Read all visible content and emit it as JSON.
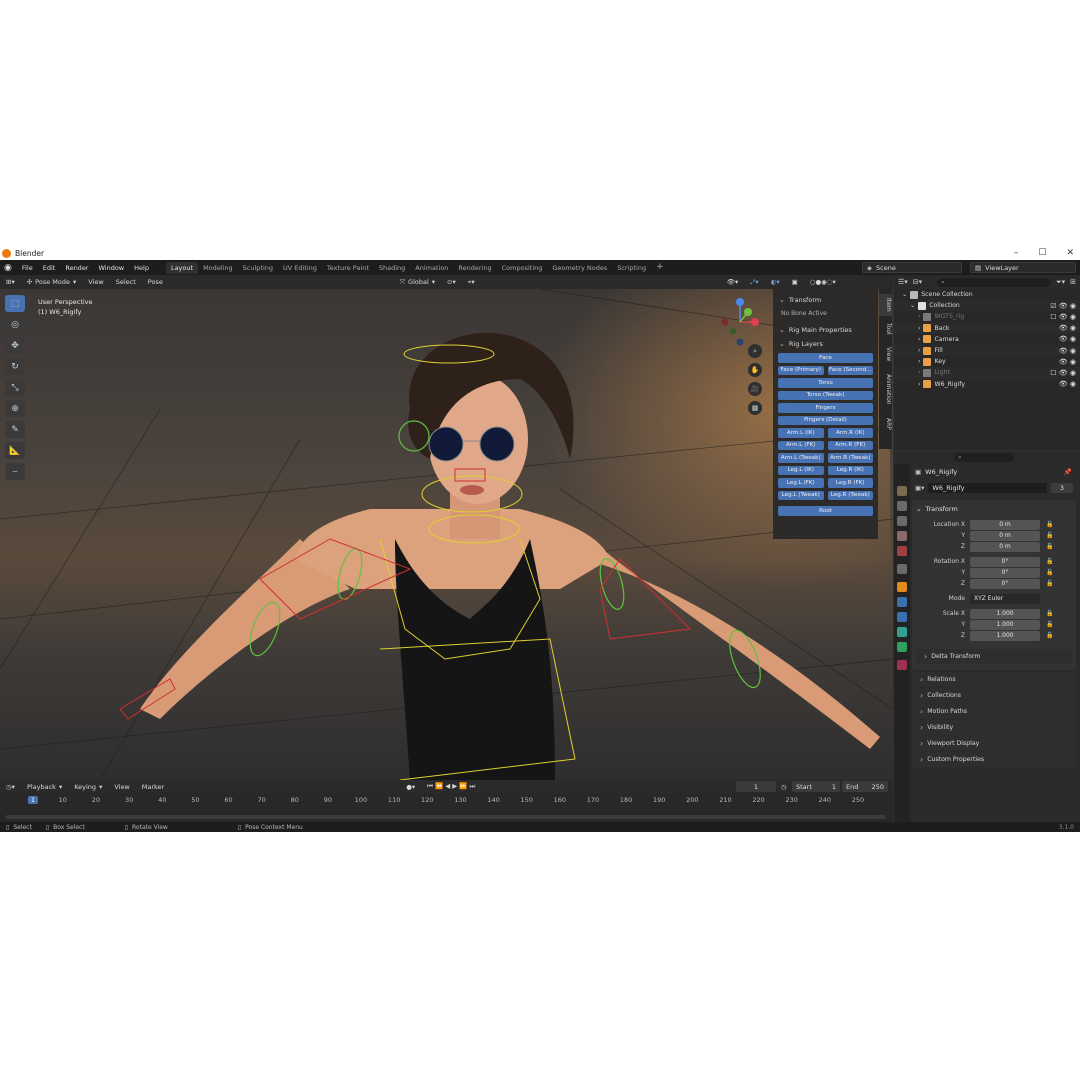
{
  "titlebar": {
    "title": "Blender",
    "minimize": "–",
    "maximize": "☐",
    "close": "✕"
  },
  "menu": [
    "File",
    "Edit",
    "Render",
    "Window",
    "Help"
  ],
  "workspaces": [
    "Layout",
    "Modeling",
    "Sculpting",
    "UV Editing",
    "Texture Paint",
    "Shading",
    "Animation",
    "Rendering",
    "Compositing",
    "Geometry Nodes",
    "Scripting"
  ],
  "scene": "Scene",
  "view_layer": "ViewLayer",
  "viewport_header": {
    "mode": "Pose Mode",
    "view": "View",
    "select": "Select",
    "pose": "Pose",
    "orientation": "Global",
    "pose_options": "Pose Options"
  },
  "viewport": {
    "perspective": "User Perspective",
    "object": "(1) W6_Rigify"
  },
  "npanel": {
    "transform": "Transform",
    "no_bone": "No Bone Active",
    "rig_main": "Rig Main Properties",
    "rig_layers": "Rig Layers",
    "layers": [
      [
        "Face"
      ],
      [
        "Face (Primary)",
        "Face (Second..."
      ],
      [
        "Torso"
      ],
      [
        "Torso (Tweak)"
      ],
      [
        "Fingers"
      ],
      [
        "Fingers (Detail)"
      ],
      [
        "Arm.L (IK)",
        "Arm.R (IK)"
      ],
      [
        "Arm.L (FK)",
        "Arm.R (FK)"
      ],
      [
        "Arm.L (Tweak)",
        "Arm.R (Tweak)"
      ],
      [
        "Leg.L (IK)",
        "Leg.R (IK)"
      ],
      [
        "Leg.L (FK)",
        "Leg.R (FK)"
      ],
      [
        "Leg.L (Tweak)",
        "Leg.R (Tweak)"
      ],
      [
        "Root"
      ]
    ],
    "tabs": [
      "Item",
      "Tool",
      "View",
      "Animation",
      "ARP"
    ]
  },
  "timeline": {
    "playback": "Playback",
    "keying": "Keying",
    "view": "View",
    "marker": "Marker",
    "current_frame": "1",
    "start_label": "Start",
    "start": "1",
    "end_label": "End",
    "end": "250",
    "ticks": [
      "1",
      "10",
      "20",
      "30",
      "40",
      "50",
      "60",
      "70",
      "80",
      "90",
      "100",
      "110",
      "120",
      "130",
      "140",
      "150",
      "160",
      "170",
      "180",
      "190",
      "200",
      "210",
      "220",
      "230",
      "240",
      "250"
    ]
  },
  "statusbar": {
    "select": "Select",
    "box_select": "Box Select",
    "rotate": "Rotate View",
    "context": "Pose Context Menu",
    "version": "3.1.0"
  },
  "outliner": {
    "rows": [
      {
        "label": "Scene Collection",
        "indent": 0,
        "color": "#b8b8b8"
      },
      {
        "label": "Collection",
        "indent": 1,
        "color": "#e0e0e0"
      },
      {
        "label": "WGTS_rig",
        "indent": 2,
        "color": "#7a7a7a",
        "dim": true
      },
      {
        "label": "Back",
        "indent": 2,
        "color": "#e8a040"
      },
      {
        "label": "Camera",
        "indent": 2,
        "color": "#e8a040"
      },
      {
        "label": "Fill",
        "indent": 2,
        "color": "#e8a040"
      },
      {
        "label": "Key",
        "indent": 2,
        "color": "#e8a040"
      },
      {
        "label": "Light",
        "indent": 2,
        "color": "#7a7a7a",
        "dim": true
      },
      {
        "label": "W6_Rigify",
        "indent": 2,
        "color": "#e8a040"
      }
    ]
  },
  "properties": {
    "object_name": "W6_Rigify",
    "data_name": "W6_Rigify",
    "users": "3",
    "transform": "Transform",
    "location": {
      "label": "Location X",
      "x": "0 m",
      "y": "0 m",
      "z": "0 m"
    },
    "rotation": {
      "label": "Rotation X",
      "x": "0°",
      "y": "0°",
      "z": "0°"
    },
    "mode_label": "Mode",
    "mode": "XYZ Euler",
    "scale": {
      "label": "Scale X",
      "x": "1.000",
      "y": "1.000",
      "z": "1.000"
    },
    "axis_y": "Y",
    "axis_z": "Z",
    "delta": "Delta Transform",
    "subpanels": [
      "Relations",
      "Collections",
      "Motion Paths",
      "Visibility",
      "Viewport Display",
      "Custom Properties"
    ]
  },
  "colors": {
    "accent": "#4772b3",
    "header": "#1d1d1d",
    "panel": "#303030"
  }
}
